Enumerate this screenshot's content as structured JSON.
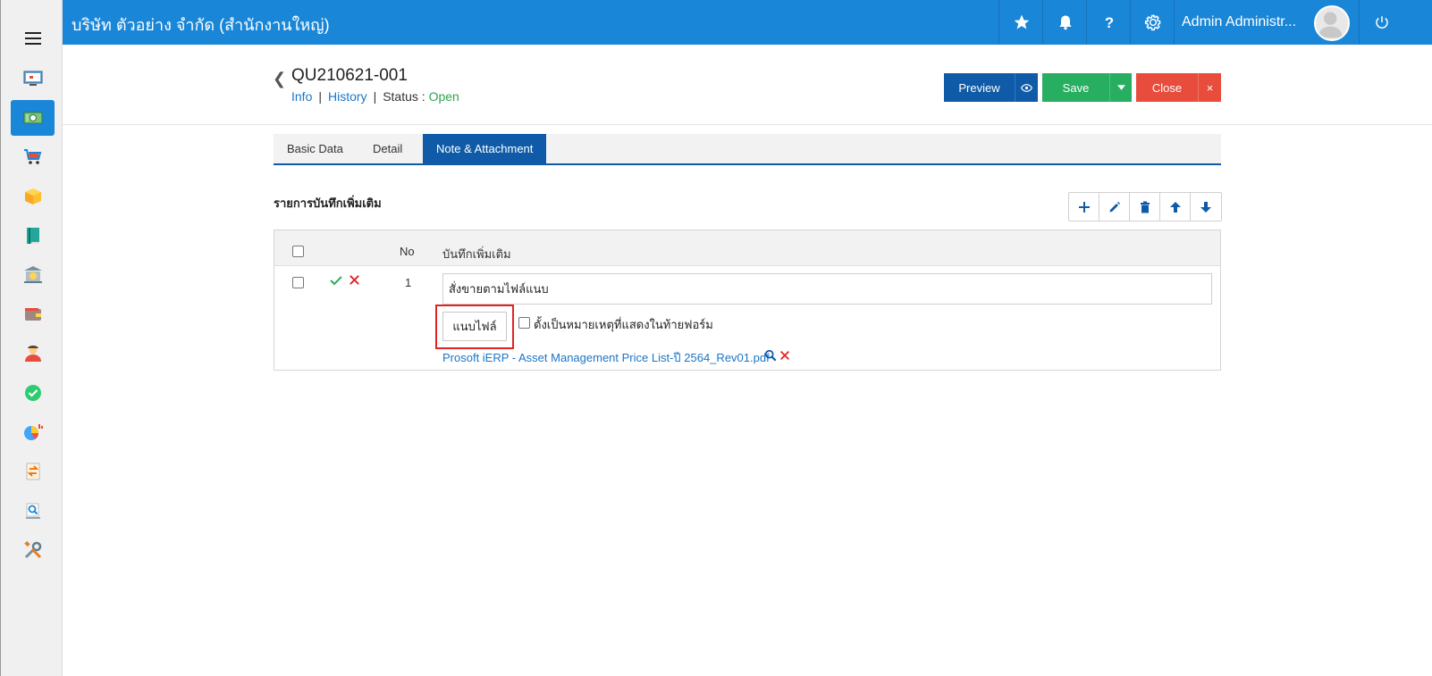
{
  "topbar": {
    "company": "บริษัท ตัวอย่าง จำกัด (สำนักงานใหญ่)",
    "user_name": "Admin Administr...",
    "icons": [
      "star-icon",
      "bell-icon",
      "help-icon",
      "gear-icon",
      "power-icon"
    ]
  },
  "sidebar": {
    "items": [
      {
        "name": "dashboard",
        "icon": "monitor-icon"
      },
      {
        "name": "sales",
        "icon": "money-icon",
        "active": true
      },
      {
        "name": "purchase",
        "icon": "cart-icon"
      },
      {
        "name": "inventory",
        "icon": "box-icon"
      },
      {
        "name": "accounting",
        "icon": "book-icon"
      },
      {
        "name": "bank",
        "icon": "bank-icon"
      },
      {
        "name": "wallet",
        "icon": "wallet-icon"
      },
      {
        "name": "hr",
        "icon": "person-icon"
      },
      {
        "name": "approval",
        "icon": "check-circle-icon"
      },
      {
        "name": "reports",
        "icon": "pie-chart-icon"
      },
      {
        "name": "transfer",
        "icon": "transfer-icon"
      },
      {
        "name": "search",
        "icon": "search-doc-icon"
      },
      {
        "name": "tools",
        "icon": "tools-icon"
      }
    ]
  },
  "document": {
    "title": "QU210621-001",
    "info_link": "Info",
    "history_link": "History",
    "sep": "|",
    "status_label": "Status",
    "status_colon": ":",
    "status_value": "Open"
  },
  "actions": {
    "preview": "Preview",
    "save": "Save",
    "close": "Close",
    "close_x": "×"
  },
  "tabs": [
    {
      "label": "Basic Data"
    },
    {
      "label": "Detail"
    },
    {
      "label": "Note & Attachment",
      "active": true
    }
  ],
  "notes": {
    "section_title": "รายการบันทึกเพิ่มเติม",
    "columns": {
      "no": "No",
      "note": "บันทึกเพิ่มเติม"
    },
    "rows": [
      {
        "no": "1",
        "note": "สั่งขายตามไฟล์แนบ",
        "attach_button": "แนบไฟล์",
        "remark_label": "ตั้งเป็นหมายเหตุที่แสดงในท้ายฟอร์ม",
        "file_name": "Prosoft iERP - Asset Management Price List-ปี 2564_Rev01.pdf"
      }
    ]
  },
  "colors": {
    "primary": "#1a86d8",
    "dark_blue": "#0f5ba8",
    "save_green": "#27ae60",
    "close_red": "#e74c3c",
    "status_green": "#2ea44f",
    "highlight_red": "#e02424"
  }
}
